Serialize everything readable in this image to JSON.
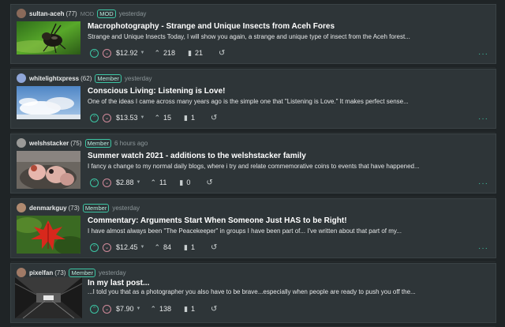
{
  "posts": [
    {
      "author": "sultan-aceh",
      "reputation": "(77)",
      "mod_text": "MOD",
      "badge": "MOD",
      "time": "yesterday",
      "title": "Macrophotography - Strange and Unique Insects from Aceh Fores",
      "excerpt": "Strange and Unique Insects Today, I will show you again, a strange and unique type of insect from the Aceh forest...",
      "payout": "$12.92",
      "votes": "218",
      "comments": "21",
      "avatar_color": "#8a6a5a",
      "thumb_icon": "insect-photo"
    },
    {
      "author": "whitelightxpress",
      "reputation": "(62)",
      "badge": "Member",
      "time": "yesterday",
      "title": "Conscious Living: Listening is Love!",
      "excerpt": "One of the ideas I came across many years ago is the simple one that \"Listening is Love.\" It makes perfect sense...",
      "payout": "$13.53",
      "votes": "15",
      "comments": "1",
      "avatar_color": "#8fa6d8",
      "thumb_icon": "sky-clouds-photo"
    },
    {
      "author": "welshstacker",
      "reputation": "(75)",
      "badge": "Member",
      "time": "6 hours ago",
      "title": "Summer watch 2021 - additions to the welshstacker family",
      "excerpt": "I fancy a change to my normal daily blogs, where i try and relate commemorative coins to events that have happened...",
      "payout": "$2.88",
      "votes": "11",
      "comments": "0",
      "avatar_color": "#9a9a98",
      "thumb_icon": "baby-birds-photo"
    },
    {
      "author": "denmarkguy",
      "reputation": "(73)",
      "badge": "Member",
      "time": "yesterday",
      "title": "Commentary: Arguments Start When Someone Just HAS to be Right!",
      "excerpt": "I have almost always been \"The Peacekeeper\" in groups I have been part of... I've written about that part of my...",
      "payout": "$12.45",
      "votes": "84",
      "comments": "1",
      "avatar_color": "#b08a70",
      "thumb_icon": "red-leaf-photo"
    },
    {
      "author": "pixelfan",
      "reputation": "(73)",
      "badge": "Member",
      "time": "yesterday",
      "title": "In my last post...",
      "excerpt": "...I told you that as a photographer you also have to be brave...especially when people are ready to push you off the...",
      "payout": "$7.90",
      "votes": "138",
      "comments": "1",
      "avatar_color": "#a07a66",
      "thumb_icon": "tunnel-photo"
    }
  ],
  "colors": {
    "accent": "#3cc6a4",
    "downvote": "#d08a9a",
    "card_bg": "#2e3538",
    "page_bg": "#1f2426"
  }
}
